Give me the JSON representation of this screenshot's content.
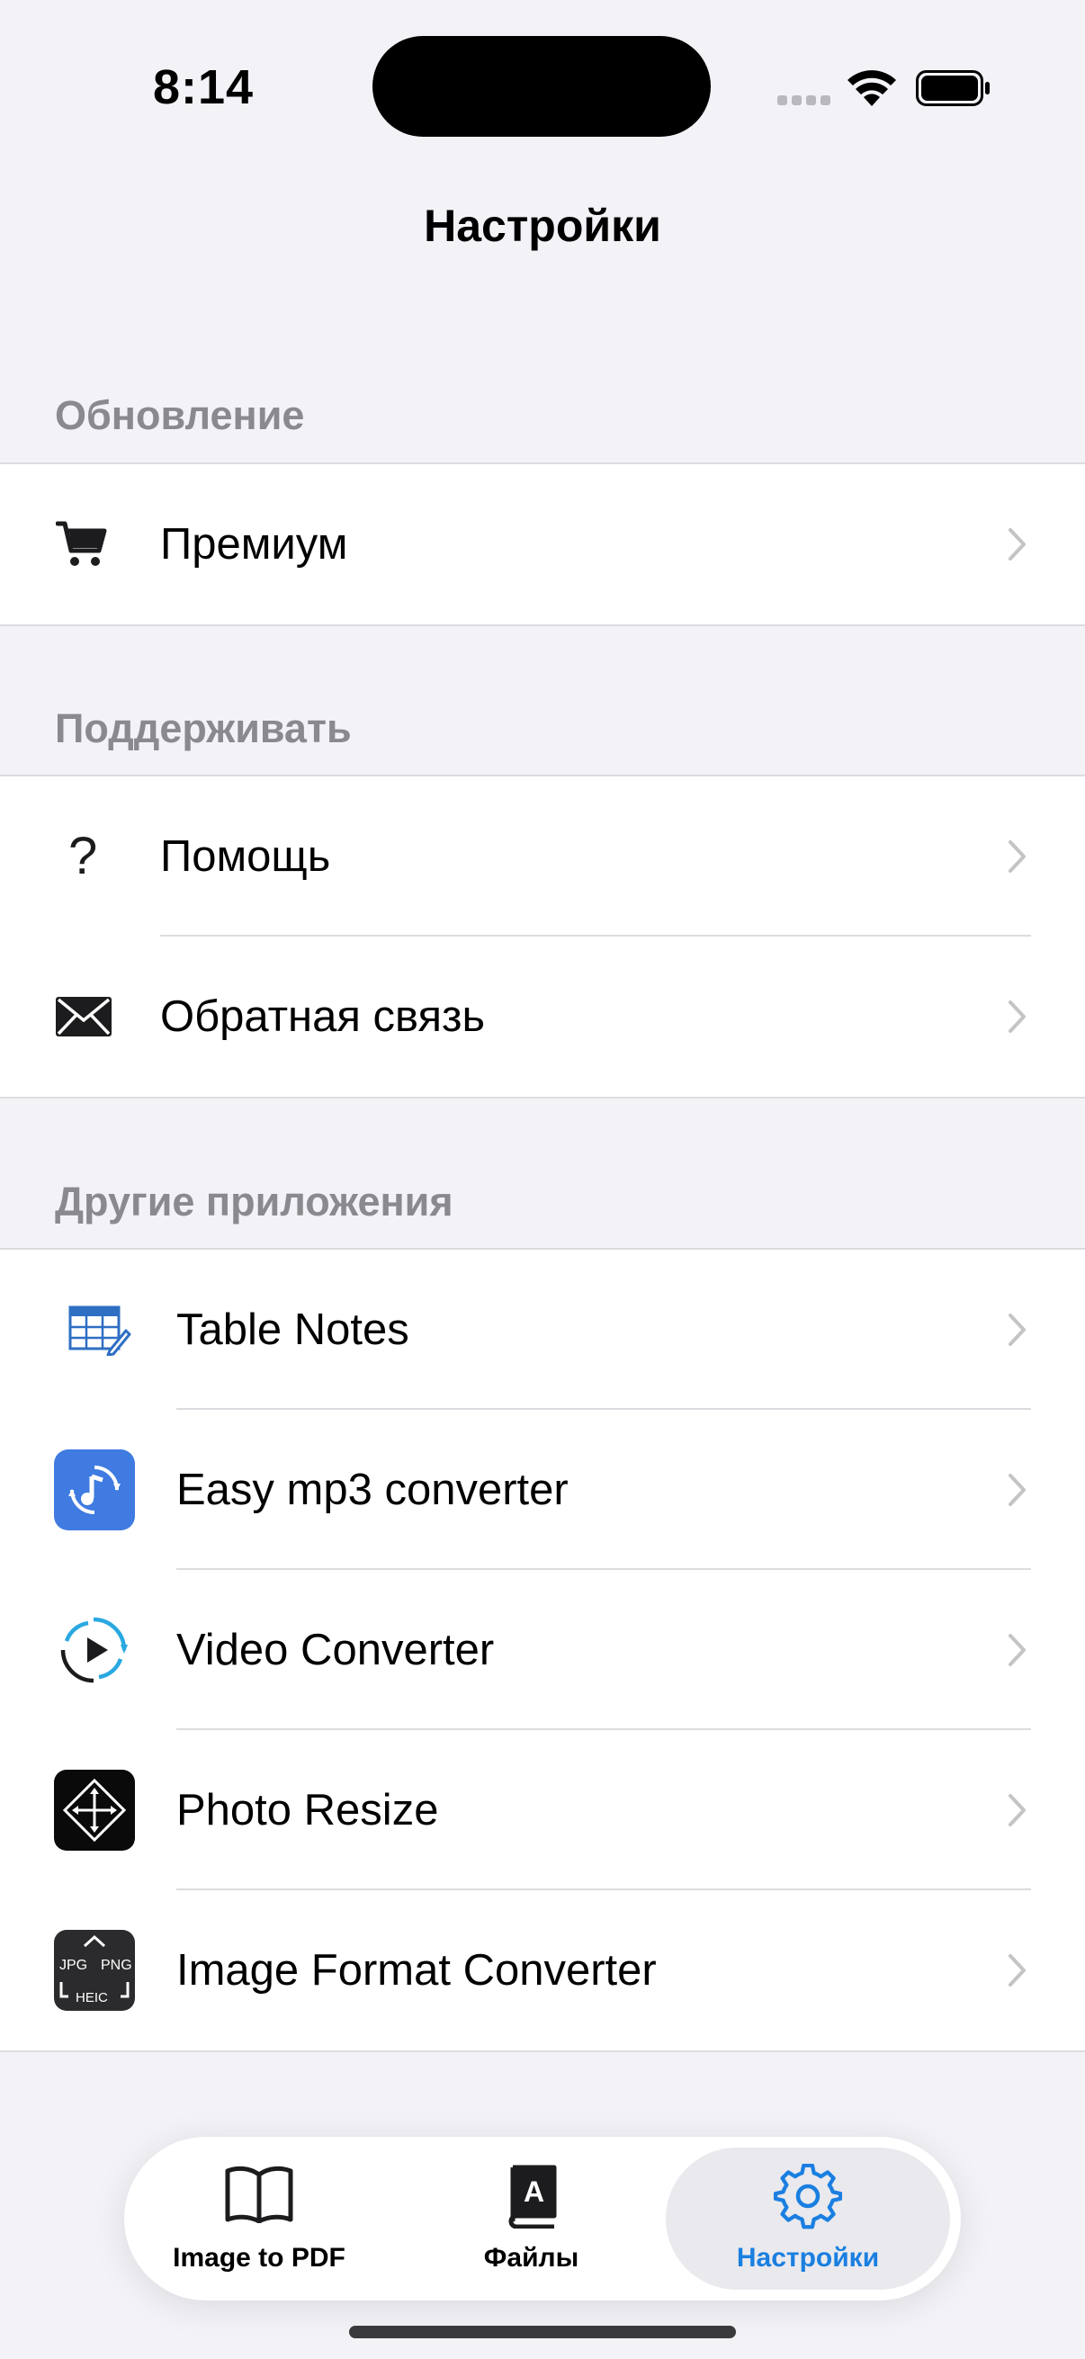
{
  "status": {
    "time": "8:14"
  },
  "nav": {
    "title": "Настройки"
  },
  "sections": {
    "update": {
      "header": "Обновление",
      "premium": "Премиум"
    },
    "support": {
      "header": "Поддерживать",
      "help": "Помощь",
      "feedback": "Обратная связь"
    },
    "apps": {
      "header": "Другие приложения",
      "items": [
        {
          "label": "Table Notes",
          "icon": "table-notes-icon"
        },
        {
          "label": "Easy mp3 converter",
          "icon": "mp3-converter-icon"
        },
        {
          "label": "Video Converter",
          "icon": "video-converter-icon"
        },
        {
          "label": "Photo Resize",
          "icon": "photo-resize-icon"
        },
        {
          "label": "Image Format Converter",
          "icon": "image-format-converter-icon"
        }
      ],
      "image_format_icon_text": {
        "jpg": "JPG",
        "png": "PNG",
        "heic": "HEIC"
      }
    }
  },
  "tabbar": {
    "tabs": [
      {
        "label": "Image to PDF",
        "icon": "book-icon"
      },
      {
        "label": "Файлы",
        "icon": "files-book-icon",
        "glyph": "A"
      },
      {
        "label": "Настройки",
        "icon": "gear-icon",
        "active": true
      }
    ]
  },
  "colors": {
    "accent": "#1a7fe0",
    "background": "#f2f2f7",
    "secondary_text": "#8a8a8e"
  }
}
